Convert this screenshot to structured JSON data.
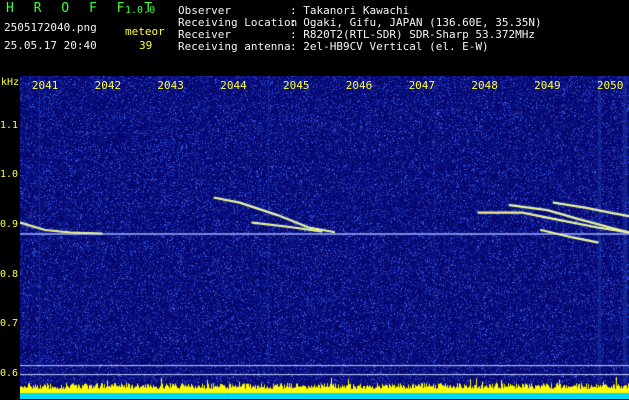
{
  "header": {
    "app_name": "H R O F F T",
    "version": "1.0.0",
    "filename": "2505172040.png",
    "datetime": "25.05.17 20:40",
    "meteor_label": "meteor",
    "meteor_count": "39",
    "fields": [
      {
        "label": "Observer",
        "value": ": Takanori Kawachi"
      },
      {
        "label": "Receiving Location",
        "value": ": Ogaki, Gifu, JAPAN (136.60E, 35.35N)"
      },
      {
        "label": "Receiver",
        "value": ": R820T2(RTL-SDR) SDR-Sharp 53.372MHz"
      },
      {
        "label": "Receiving antenna",
        "value": ": 2el-HB9CV Vertical (el. E-W)"
      }
    ]
  },
  "chart_data": {
    "type": "heatmap",
    "ylabel": "kHz",
    "y_ticks": [
      "1.1",
      "1.0",
      "0.9",
      "0.8",
      "0.7",
      "0.6"
    ],
    "y_tick_values": [
      1.1,
      1.0,
      0.9,
      0.8,
      0.7,
      0.6
    ],
    "ylim": [
      0.58,
      1.2
    ],
    "x_ticks": [
      "2041",
      "2042",
      "2043",
      "2044",
      "2045",
      "2046",
      "2047",
      "2048",
      "2049",
      "2050"
    ],
    "x_tick_values": [
      2041,
      2042,
      2043,
      2044,
      2045,
      2046,
      2047,
      2048,
      2049,
      2050
    ],
    "xlim": [
      2040.6,
      2050.3
    ],
    "carrier_khz": 0.882,
    "meteor_tracks": [
      {
        "points": [
          [
            2040.6,
            0.905
          ],
          [
            2041.0,
            0.89
          ],
          [
            2041.4,
            0.885
          ],
          [
            2041.9,
            0.883
          ]
        ]
      },
      {
        "points": [
          [
            2043.7,
            0.955
          ],
          [
            2044.1,
            0.945
          ],
          [
            2044.7,
            0.92
          ],
          [
            2045.2,
            0.895
          ],
          [
            2045.6,
            0.886
          ]
        ]
      },
      {
        "points": [
          [
            2044.3,
            0.905
          ],
          [
            2044.9,
            0.896
          ],
          [
            2045.4,
            0.887
          ]
        ]
      },
      {
        "points": [
          [
            2047.9,
            0.925
          ],
          [
            2048.6,
            0.925
          ],
          [
            2049.2,
            0.91
          ],
          [
            2049.8,
            0.895
          ],
          [
            2050.3,
            0.885
          ]
        ]
      },
      {
        "points": [
          [
            2048.4,
            0.94
          ],
          [
            2049.0,
            0.93
          ],
          [
            2049.5,
            0.912
          ],
          [
            2050.0,
            0.895
          ],
          [
            2050.3,
            0.885
          ]
        ]
      },
      {
        "points": [
          [
            2049.1,
            0.945
          ],
          [
            2049.6,
            0.935
          ],
          [
            2050.0,
            0.925
          ],
          [
            2050.3,
            0.918
          ]
        ]
      },
      {
        "points": [
          [
            2048.9,
            0.89
          ],
          [
            2049.4,
            0.875
          ],
          [
            2049.8,
            0.865
          ]
        ]
      }
    ],
    "noise_line_khz": [
      0.618,
      0.6
    ],
    "colors": {
      "background": "#0a0a6e",
      "carrier": "#9fb0ff",
      "track": "#e0ffd0",
      "track_core": "#ffea50",
      "level": "#ffff00",
      "level_base": "#00d8ff",
      "vertical_band": "#1c3cb0"
    }
  }
}
